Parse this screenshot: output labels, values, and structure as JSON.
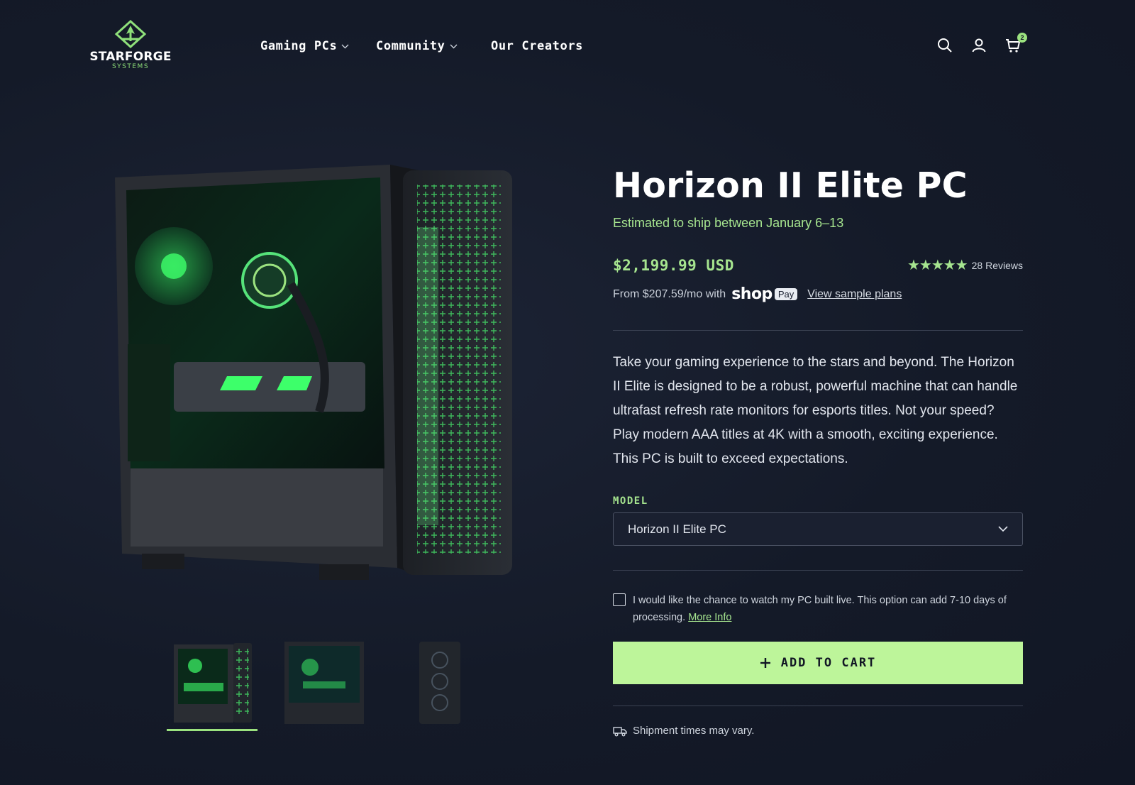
{
  "brand": {
    "name": "STARFORGE",
    "sub": "SYSTEMS",
    "accent": "#9be27f"
  },
  "nav": {
    "items": [
      {
        "label": "Gaming PCs",
        "has_dropdown": true
      },
      {
        "label": "Community",
        "has_dropdown": true
      },
      {
        "label": "Our Creators",
        "has_dropdown": false
      }
    ]
  },
  "header_icons": {
    "search": "search-icon",
    "account": "user-icon",
    "cart": "cart-icon",
    "cart_count": "2"
  },
  "product": {
    "title": "Horizon II Elite PC",
    "shipping_estimate": "Estimated to ship between January 6–13",
    "price": "$2,199.99 USD",
    "rating": {
      "stars": 5,
      "reviews_label": "28 Reviews"
    },
    "financing": {
      "prefix": "From $207.59/mo with",
      "shop": "shop",
      "pay": "Pay",
      "link": "View sample plans"
    },
    "description": "Take your gaming experience to the stars and beyond. The Horizon II Elite is designed to be a robust, powerful machine that can handle ultrafast refresh rate monitors for esports titles. Not your speed? Play modern AAA titles at 4K with a smooth, exciting experience. This PC is built to exceed expectations.",
    "model_label": "MODEL",
    "model_selected": "Horizon II Elite PC",
    "live_build_text": "I would like the chance to watch my PC built live. This option can add 7-10 days of processing.",
    "more_info": "More Info",
    "add_to_cart": "ADD TO CART",
    "shipment_note": "Shipment times may vary."
  },
  "gallery": {
    "thumbnail_count": 3,
    "active_thumbnail": 0
  },
  "colors": {
    "background": "#141a28",
    "accent_green": "#a6e58f",
    "button": "#bdf59a"
  }
}
